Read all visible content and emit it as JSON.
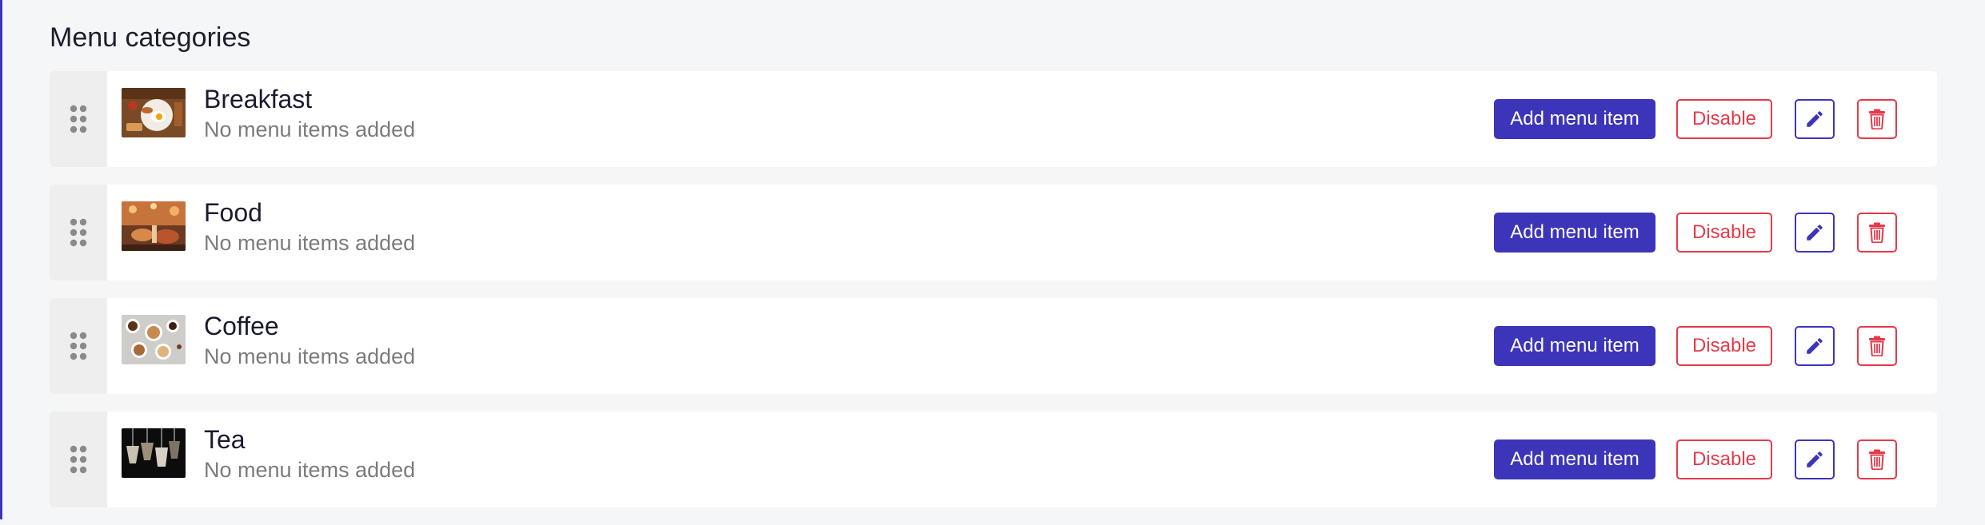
{
  "page": {
    "title": "Menu categories"
  },
  "colors": {
    "accent": "#3d35b9",
    "danger": "#e53a4a",
    "background": "#f5f6f8",
    "handle_bg": "#eeeeee"
  },
  "actions": {
    "add_label": "Add menu item",
    "disable_label": "Disable",
    "edit_icon": "pencil-icon",
    "delete_icon": "trash-icon",
    "drag_icon": "drag-handle-icon"
  },
  "categories": [
    {
      "name": "Breakfast",
      "subtitle": "No menu items added",
      "thumbnail": "breakfast-photo"
    },
    {
      "name": "Food",
      "subtitle": "No menu items added",
      "thumbnail": "food-photo"
    },
    {
      "name": "Coffee",
      "subtitle": "No menu items added",
      "thumbnail": "coffee-photo"
    },
    {
      "name": "Tea",
      "subtitle": "No menu items added",
      "thumbnail": "tea-photo"
    }
  ]
}
